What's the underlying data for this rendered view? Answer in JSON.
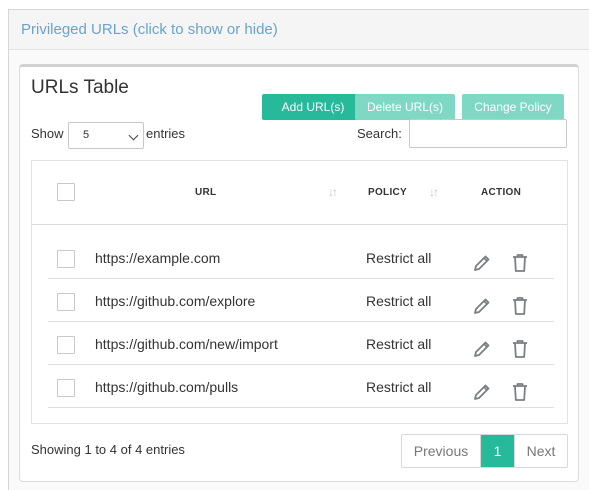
{
  "panel": {
    "title": "Privileged URLs (click to show or hide)"
  },
  "card": {
    "title": "URLs Table",
    "buttons": {
      "add": "Add URL(s)",
      "delete": "Delete URL(s)",
      "change_policy": "Change Policy"
    }
  },
  "length": {
    "show_label": "Show",
    "value": "5",
    "entries_label": "entries"
  },
  "search": {
    "label": "Search:",
    "value": ""
  },
  "table": {
    "columns": {
      "url": "URL",
      "policy": "POLICY",
      "action": "ACTION"
    },
    "rows": [
      {
        "url": "https://example.com",
        "policy": "Restrict all"
      },
      {
        "url": "https://github.com/explore",
        "policy": "Restrict all"
      },
      {
        "url": "https://github.com/new/import",
        "policy": "Restrict all"
      },
      {
        "url": "https://github.com/pulls",
        "policy": "Restrict all"
      }
    ]
  },
  "footer": {
    "info": "Showing 1 to 4 of 4 entries",
    "pagination": {
      "previous": "Previous",
      "current": "1",
      "next": "Next"
    }
  },
  "colors": {
    "accent": "#26b99a",
    "accent_light": "#7fd8c4",
    "link": "#6aa3cc"
  },
  "icons": {
    "edit": "pencil-icon",
    "delete": "trash-icon",
    "sort": "sort-icon",
    "select": "chevron-down-icon"
  }
}
